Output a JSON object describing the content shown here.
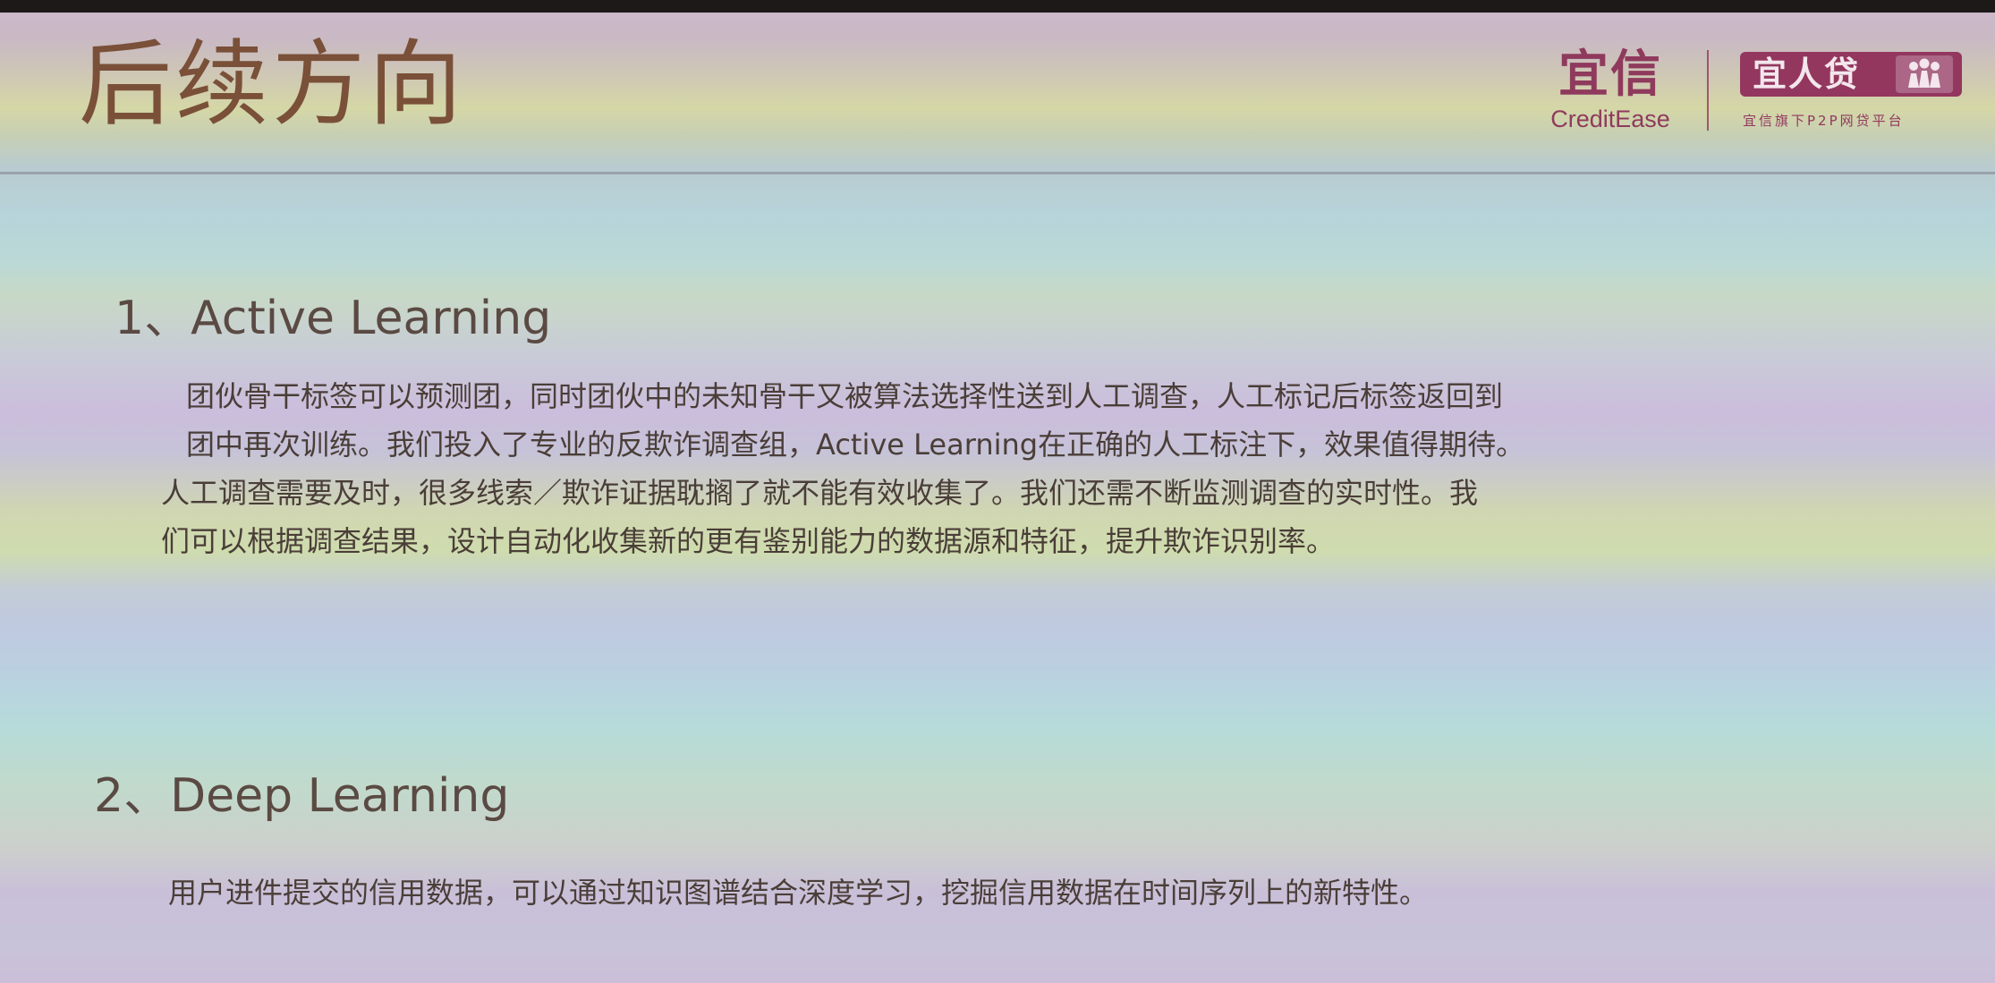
{
  "slide": {
    "title": "后续方向",
    "brand": {
      "name_cn": "宜信",
      "name_en": "CreditEase",
      "badge_text": "宜人贷",
      "badge_sub": "宜信旗下P2P网贷平台"
    },
    "sections": [
      {
        "heading": "1、Active Learning",
        "lines": [
          "团伙骨干标签可以预测团，同时团伙中的未知骨干又被算法选择性送到人工调查，人工标记后标签返回到",
          "团中再次训练。我们投入了专业的反欺诈调查组，Active Learning在正确的人工标注下，效果值得期待。",
          "人工调查需要及时，很多线索／欺诈证据耽搁了就不能有效收集了。我们还需不断监测调查的实时性。我",
          "们可以根据调查结果，设计自动化收集新的更有鉴别能力的数据源和特征，提升欺诈识别率。"
        ]
      },
      {
        "heading": "2、Deep Learning",
        "lines": [
          "用户进件提交的信用数据，可以通过知识图谱结合深度学习，挖掘信用数据在时间序列上的新特性。"
        ]
      }
    ],
    "colors": {
      "title": "#7a5039",
      "brand": "#93375f",
      "text": "#4a3e38"
    },
    "icons": [
      "people-logo-icon"
    ]
  }
}
